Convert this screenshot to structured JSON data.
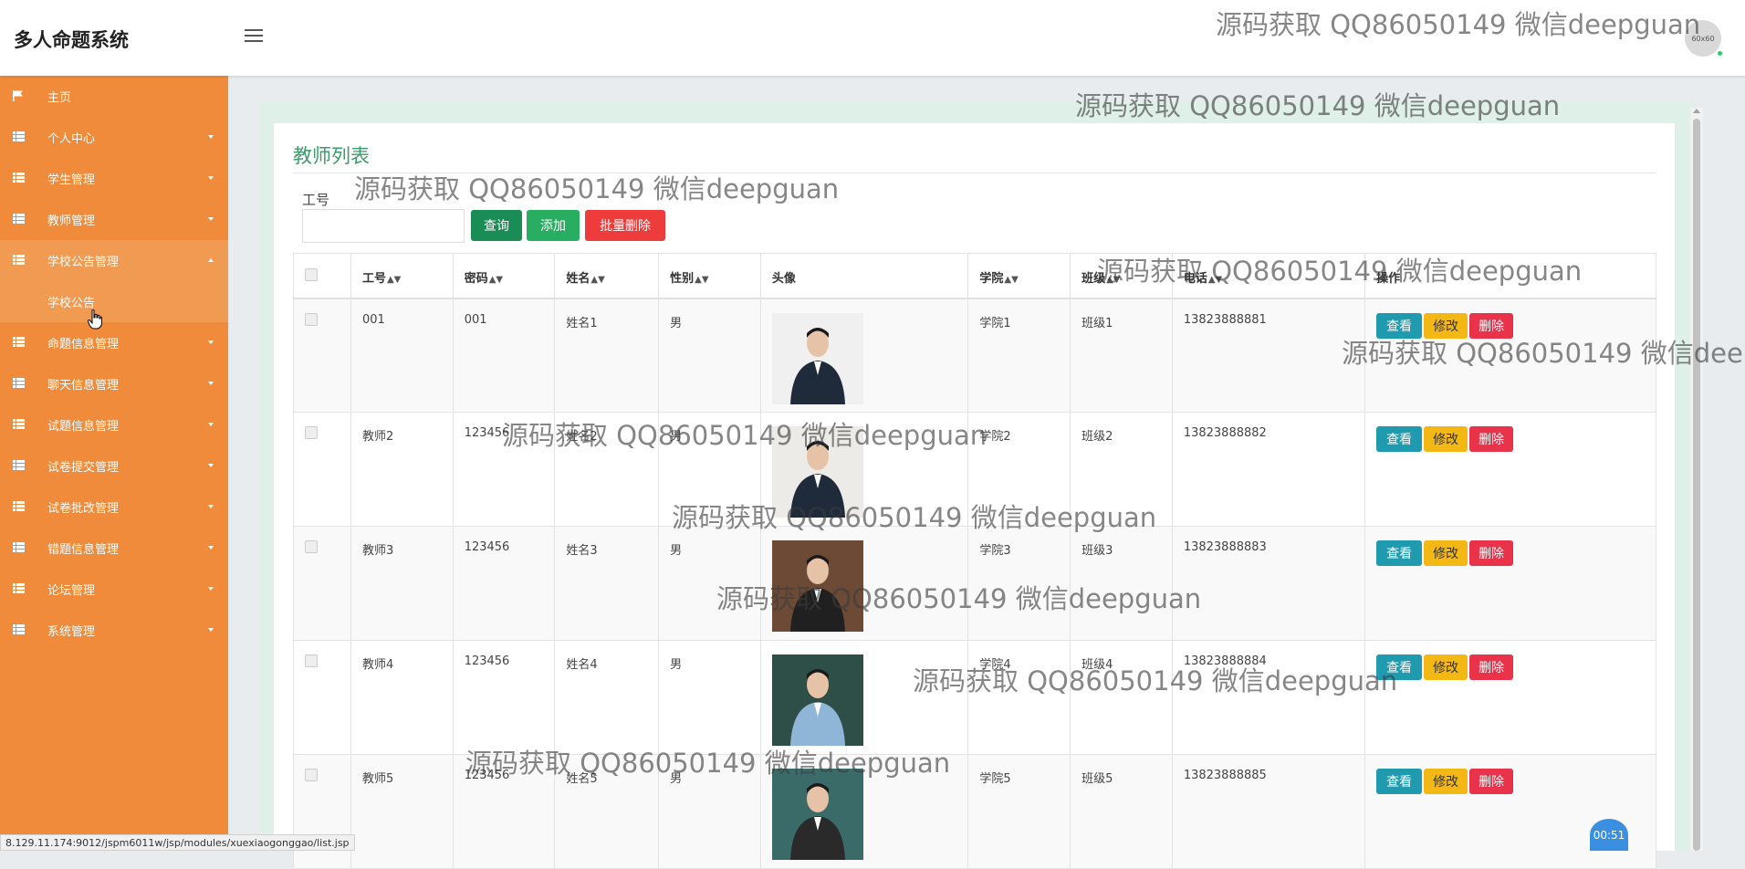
{
  "app": {
    "title": "多人命题系统",
    "avatar_text": "60x60"
  },
  "sidebar": {
    "items": [
      {
        "label": "主页",
        "icon": "flag-icon",
        "caret": ""
      },
      {
        "label": "个人中心",
        "icon": "grid-icon",
        "caret": "down"
      },
      {
        "label": "学生管理",
        "icon": "grid-icon",
        "caret": "down"
      },
      {
        "label": "教师管理",
        "icon": "grid-icon",
        "caret": "down"
      },
      {
        "label": "学校公告管理",
        "icon": "grid-icon",
        "caret": "up",
        "active": true
      },
      {
        "label": "命题信息管理",
        "icon": "grid-icon",
        "caret": "down"
      },
      {
        "label": "聊天信息管理",
        "icon": "grid-icon",
        "caret": "down"
      },
      {
        "label": "试题信息管理",
        "icon": "grid-icon",
        "caret": "down"
      },
      {
        "label": "试卷提交管理",
        "icon": "grid-icon",
        "caret": "down"
      },
      {
        "label": "试卷批改管理",
        "icon": "grid-icon",
        "caret": "down"
      },
      {
        "label": "错题信息管理",
        "icon": "grid-icon",
        "caret": "down"
      },
      {
        "label": "论坛管理",
        "icon": "grid-icon",
        "caret": "down"
      },
      {
        "label": "系统管理",
        "icon": "grid-icon",
        "caret": "down"
      }
    ],
    "sub_item": "学校公告"
  },
  "main": {
    "title": "教师列表",
    "search": {
      "label": "工号",
      "value": "",
      "placeholder": ""
    },
    "buttons": {
      "query": "查询",
      "add": "添加",
      "batch_delete": "批量删除"
    }
  },
  "table": {
    "headers": [
      "工号",
      "密码",
      "姓名",
      "性别",
      "头像",
      "学院",
      "班级",
      "电话",
      "操作"
    ],
    "sortable": [
      true,
      true,
      true,
      true,
      false,
      true,
      true,
      true,
      false
    ],
    "rows": [
      {
        "id": "001",
        "password": "001",
        "name": "姓名1",
        "gender": "男",
        "college": "学院1",
        "class": "班级1",
        "phone": "13823888881"
      },
      {
        "id": "教师2",
        "password": "123456",
        "name": "姓名2",
        "gender": "男",
        "college": "学院2",
        "class": "班级2",
        "phone": "13823888882"
      },
      {
        "id": "教师3",
        "password": "123456",
        "name": "姓名3",
        "gender": "男",
        "college": "学院3",
        "class": "班级3",
        "phone": "13823888883"
      },
      {
        "id": "教师4",
        "password": "123456",
        "name": "姓名4",
        "gender": "男",
        "college": "学院4",
        "class": "班级4",
        "phone": "13823888884"
      },
      {
        "id": "教师5",
        "password": "123456",
        "name": "姓名5",
        "gender": "男",
        "college": "学院5",
        "class": "班级5",
        "phone": "13823888885"
      }
    ],
    "ops": {
      "view": "查看",
      "edit": "修改",
      "delete": "删除"
    }
  },
  "watermark": "源码获取 QQ86050149 微信deepguan",
  "status_url": "8.129.11.174:9012/jspm6011w/jsp/modules/xuexiaogonggao/list.jsp",
  "timer": "00:51",
  "colors": {
    "sidebar": "#ef8b3b",
    "title": "#3a9d6b",
    "query": "#1a8c55",
    "add": "#27ae60",
    "danger": "#ee3b3b",
    "view": "#1f9aae",
    "edit": "#f3b814"
  }
}
